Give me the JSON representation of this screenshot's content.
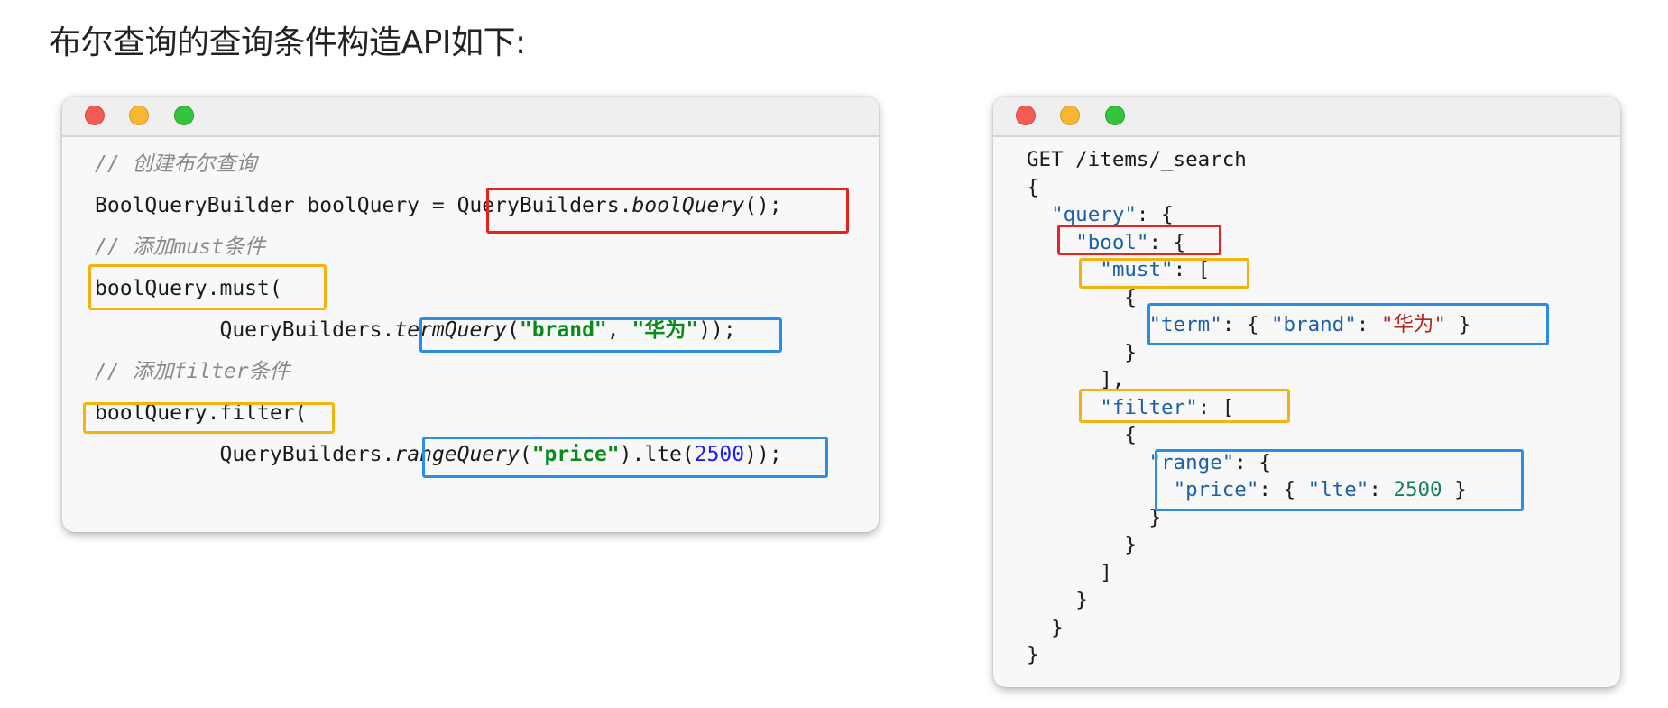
{
  "heading": "布尔查询的查询条件构造API如下:",
  "left_window": {
    "lines": [
      {
        "comment": "// 创建布尔查询"
      },
      {
        "pre": "BoolQueryBuilder boolQuery = ",
        "cls": "QueryBuilders.",
        "method": "boolQuery",
        "post": "();"
      },
      {
        "comment": "// 添加must条件"
      },
      {
        "text": "boolQuery.must("
      },
      {
        "indent": "          ",
        "cls": "QueryBuilders.",
        "method": "termQuery",
        "open": "(",
        "arg1": "\"brand\"",
        "sep": ", ",
        "arg2": "\"华为\"",
        "close": "));"
      },
      {
        "comment": "// 添加filter条件"
      },
      {
        "text": "boolQuery.filter("
      },
      {
        "indent": "          ",
        "cls": "QueryBuilders.",
        "method": "rangeQuery",
        "open": "(",
        "arg1": "\"price\"",
        "mid": ").lte(",
        "num": "2500",
        "close": "));"
      }
    ]
  },
  "right_window": {
    "l1": "GET /items/_search",
    "l2": "{",
    "l3_key": "\"query\"",
    "l3_rest": ": {",
    "l4_key": "\"bool\"",
    "l4_rest": ": {",
    "l5_key": "\"must\"",
    "l5_rest": ": [",
    "l6": "{",
    "l7_key1": "\"term\"",
    "l7_mid1": ": { ",
    "l7_key2": "\"brand\"",
    "l7_mid2": ": ",
    "l7_val": "\"华为\"",
    "l7_end": " }",
    "l8": "}",
    "l9": "],",
    "l10_key": "\"filter\"",
    "l10_rest": ": [",
    "l11": "{",
    "l12_key": "\"range\"",
    "l12_rest": ": {",
    "l13_key1": "\"price\"",
    "l13_mid1": ": { ",
    "l13_key2": "\"lte\"",
    "l13_mid2": ": ",
    "l13_val": "2500",
    "l13_end": " }",
    "l14": "}",
    "l15": "}",
    "l16": "]",
    "l17": "}",
    "l18": "}",
    "l19": "}"
  },
  "colors": {
    "red_box": "#e8231d",
    "orange_box": "#f4b40f",
    "blue_box": "#2b8ee6"
  }
}
